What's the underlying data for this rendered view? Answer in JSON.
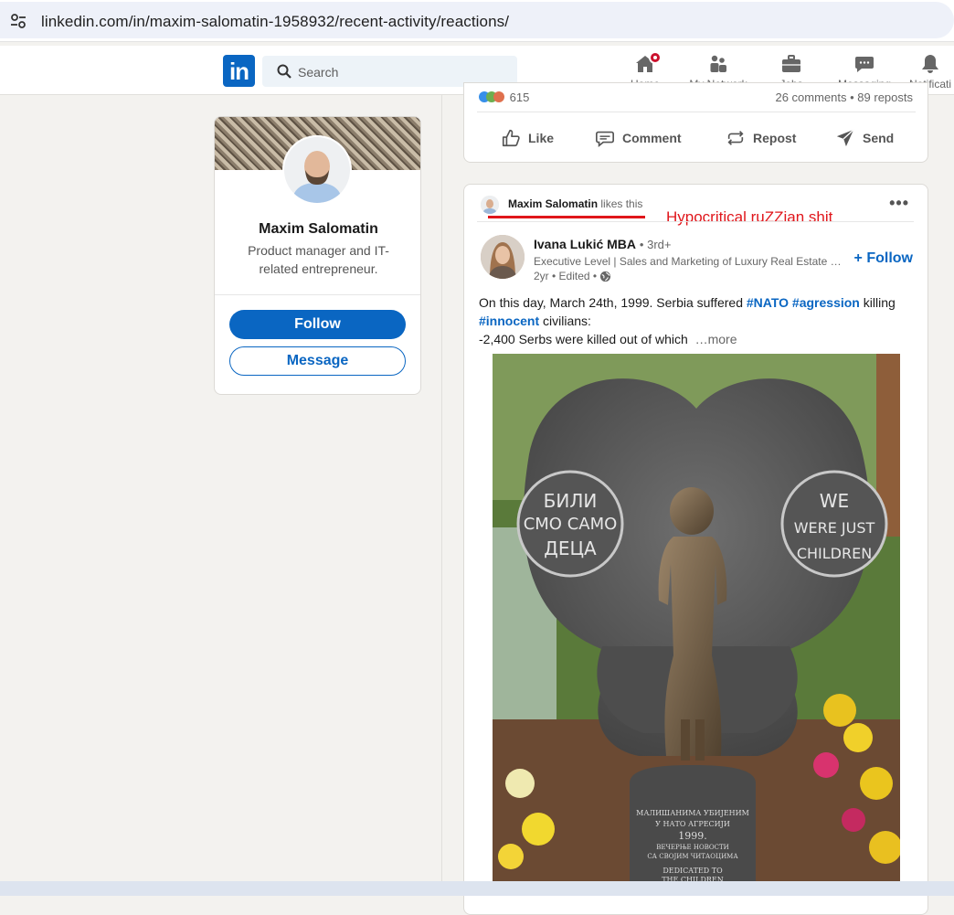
{
  "browser": {
    "url": "linkedin.com/in/maxim-salomatin-1958932/recent-activity/reactions/"
  },
  "nav": {
    "search_placeholder": "Search",
    "items": [
      {
        "label": "Home",
        "icon": "home-icon"
      },
      {
        "label": "My Network",
        "icon": "network-icon"
      },
      {
        "label": "Jobs",
        "icon": "briefcase-icon"
      },
      {
        "label": "Messaging",
        "icon": "messaging-icon"
      },
      {
        "label": "Notificati",
        "icon": "bell-icon"
      }
    ],
    "colors": {
      "brand": "#0a66c2",
      "badge": "#cb112d"
    }
  },
  "profile": {
    "name": "Maxim Salomatin",
    "headline": "Product manager and IT-related entrepreneur.",
    "follow_label": "Follow",
    "message_label": "Message"
  },
  "previous_post": {
    "reactions_count": "615",
    "stats": "26 comments • 89 reposts",
    "actions": [
      "Like",
      "Comment",
      "Repost",
      "Send"
    ]
  },
  "post": {
    "liker_name": "Maxim Salomatin",
    "liker_suffix": "likes this",
    "annotation": "Hypocritical ruZZian shit",
    "author": {
      "name": "Ivana Lukić MBA",
      "degree": "• 3rd+",
      "headline": "Executive Level | Sales and Marketing of Luxury Real Estate and Hospitality",
      "meta": "2yr • Edited •"
    },
    "follow_label": "+ Follow",
    "text": {
      "line1_pre": "On this day, March 24th, 1999. Serbia suffered ",
      "tag_nato": "#NATO",
      "tag_agression": "#agression",
      "line1_post": " killing",
      "tag_innocent": "#innocent",
      "line2_post": " civilians:",
      "line3": "-2,400 Serbs were killed out of which",
      "more": "…more"
    },
    "image": {
      "left_circle": [
        "БИЛИ",
        "СМО САМО",
        "ДЕЦА"
      ],
      "right_circle": [
        "WE",
        "WERE JUST",
        "CHILDREN"
      ],
      "plaque": [
        "МАЛИШАНИМА УБИЈЕНИМ",
        "У НАТО АГРЕСИЈИ",
        "1999.",
        "ВЕЧЕРЊЕ НОВОСТИ",
        "СА СВОЈИМ ЧИТАОЦИМА",
        "DEDICATED TO",
        "THE CHILDREN"
      ]
    }
  }
}
